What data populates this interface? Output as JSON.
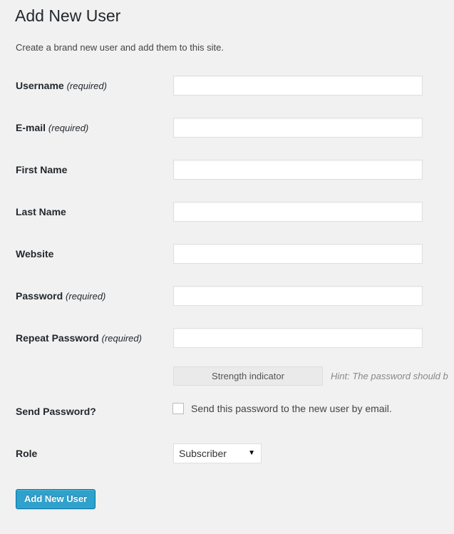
{
  "page": {
    "title": "Add New User",
    "subtitle": "Create a brand new user and add them to this site."
  },
  "form": {
    "fields": [
      {
        "label": "Username",
        "required_note": "(required)",
        "value": "",
        "name": "username"
      },
      {
        "label": "E-mail",
        "required_note": "(required)",
        "value": "",
        "name": "email"
      },
      {
        "label": "First Name",
        "required_note": "",
        "value": "",
        "name": "first-name"
      },
      {
        "label": "Last Name",
        "required_note": "",
        "value": "",
        "name": "last-name"
      },
      {
        "label": "Website",
        "required_note": "",
        "value": "",
        "name": "website"
      },
      {
        "label": "Password",
        "required_note": "(required)",
        "value": "",
        "name": "password"
      },
      {
        "label": "Repeat Password",
        "required_note": "(required)",
        "value": "",
        "name": "repeat-password"
      }
    ],
    "strength_indicator": "Strength indicator",
    "password_hint": "Hint: The password should b",
    "send_password": {
      "label": "Send Password?",
      "checkbox_text": "Send this password to the new user by email.",
      "checked": false
    },
    "role": {
      "label": "Role",
      "selected": "Subscriber",
      "caret": "▼"
    },
    "submit_label": "Add New User"
  },
  "colors": {
    "background": "#f1f1f1",
    "title": "#23282d",
    "button": "#2ea2cc",
    "button_border": "#0074a2",
    "input_border": "#dfdfdf",
    "hint_text": "#888888"
  }
}
